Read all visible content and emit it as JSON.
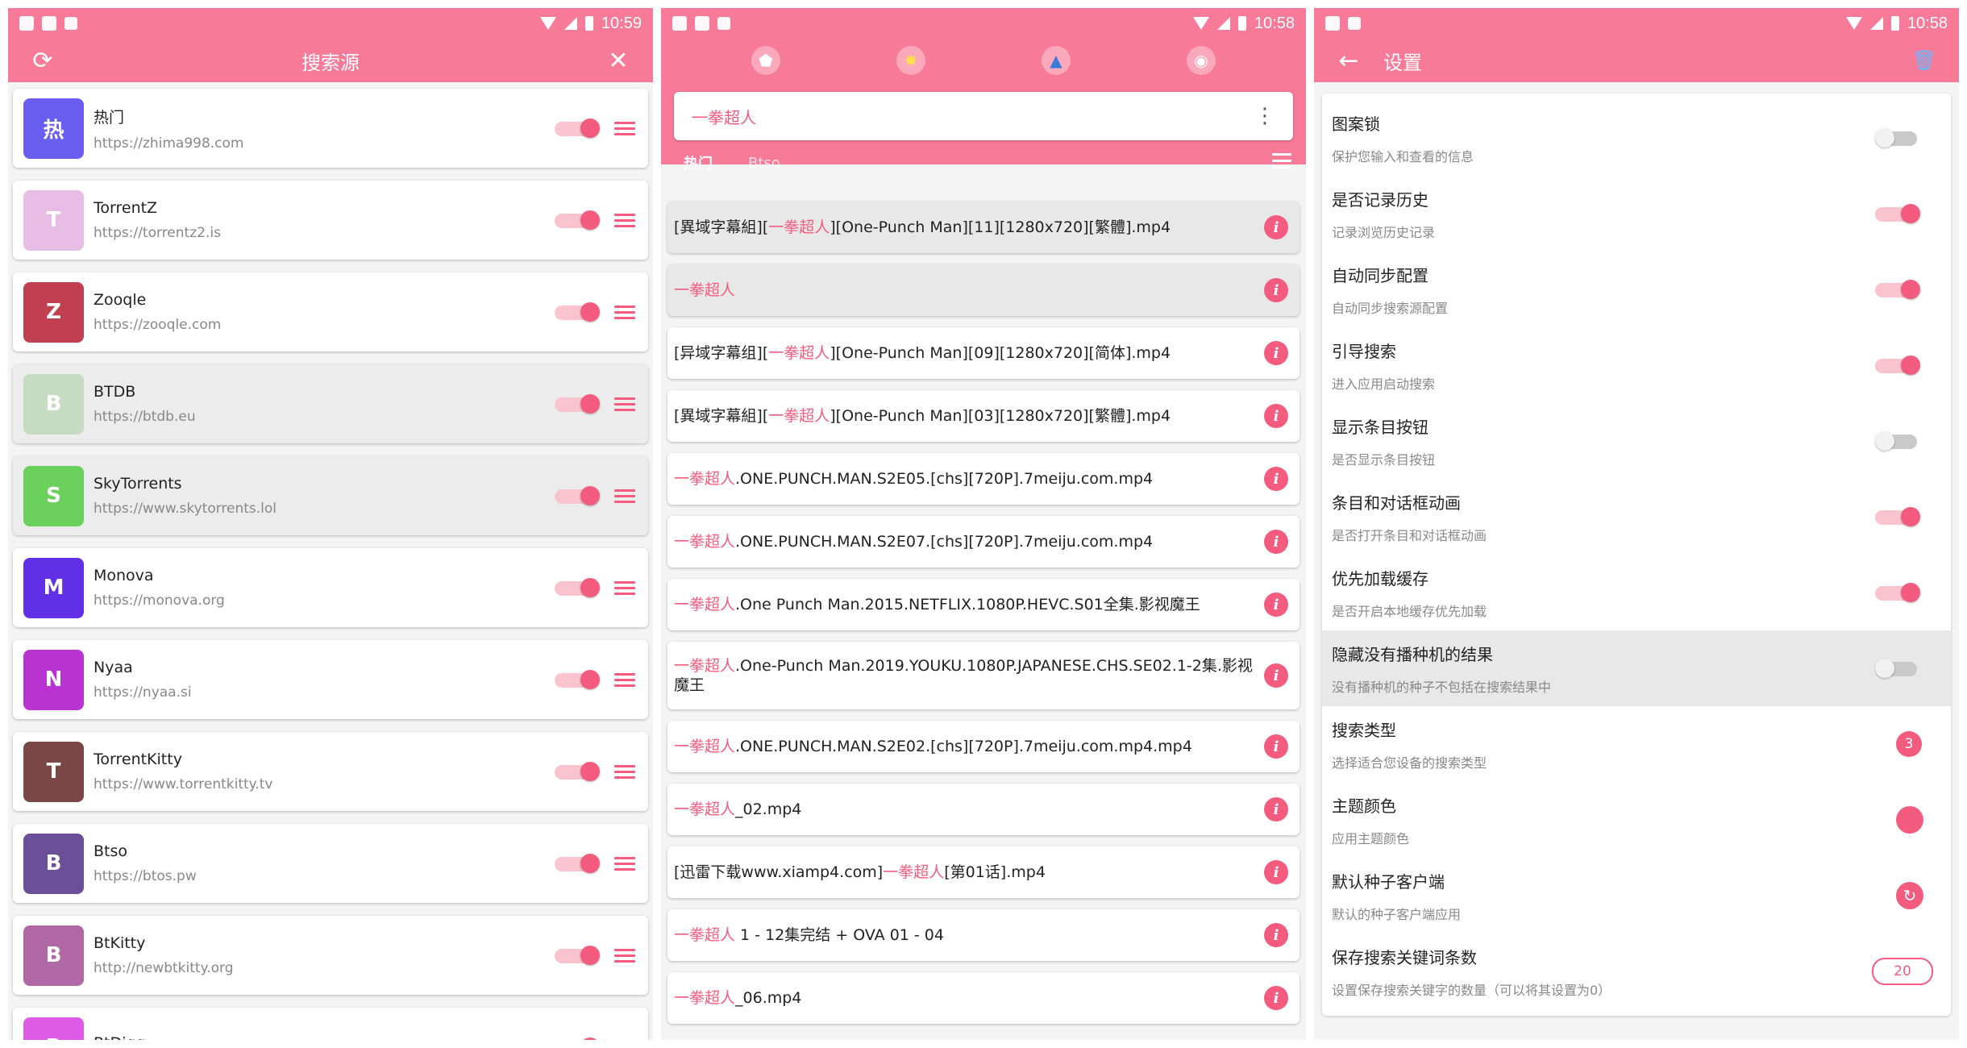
{
  "status": {
    "time1": "10:59",
    "time2": "10:58",
    "time3": "10:58"
  },
  "p1": {
    "title": "搜索源",
    "sources": [
      {
        "letter": "热",
        "name": "热门",
        "url": "https://zhima998.com",
        "color": "#6a5df2",
        "enabled": true
      },
      {
        "letter": "T",
        "name": "TorrentZ",
        "url": "https://torrentz2.is",
        "color": "#e7bde6",
        "enabled": true
      },
      {
        "letter": "Z",
        "name": "Zooqle",
        "url": "https://zooqle.com",
        "color": "#c1404f",
        "enabled": true
      },
      {
        "letter": "B",
        "name": "BTDB",
        "url": "https://btdb.eu",
        "color": "#c5dcc0",
        "enabled": true
      },
      {
        "letter": "S",
        "name": "SkyTorrents",
        "url": "https://www.skytorrents.lol",
        "color": "#6ad25c",
        "enabled": true
      },
      {
        "letter": "M",
        "name": "Monova",
        "url": "https://monova.org",
        "color": "#6130e6",
        "enabled": true
      },
      {
        "letter": "N",
        "name": "Nyaa",
        "url": "https://nyaa.si",
        "color": "#b932d2",
        "enabled": true
      },
      {
        "letter": "T",
        "name": "TorrentKitty",
        "url": "https://www.torrentkitty.tv",
        "color": "#7b4646",
        "enabled": true
      },
      {
        "letter": "B",
        "name": "Btso",
        "url": "https://btos.pw",
        "color": "#6b4f99",
        "enabled": true
      },
      {
        "letter": "B",
        "name": "BtKitty",
        "url": "http://newbtkitty.org",
        "color": "#b068a7",
        "enabled": true
      },
      {
        "letter": "B",
        "name": "BtDigg",
        "url": "",
        "color": "#e05be5",
        "enabled": true
      }
    ]
  },
  "p2": {
    "query": "一拳超人",
    "tab_hot": "热门",
    "tab_btso": "Btso",
    "results": [
      {
        "pre": "[異域字幕組][",
        "hl": "一拳超人",
        "post": "][One-Punch Man][11][1280x720][繁體].mp4"
      },
      {
        "pre": "",
        "hl": "一拳超人",
        "post": ""
      },
      {
        "pre": "[异域字幕组][",
        "hl": "一拳超人",
        "post": "][One-Punch Man][09][1280x720][简体].mp4"
      },
      {
        "pre": "[異域字幕組][",
        "hl": "一拳超人",
        "post": "][One-Punch Man][03][1280x720][繁體].mp4"
      },
      {
        "pre": "",
        "hl": "一拳超人",
        "post": ".ONE.PUNCH.MAN.S2E05.[chs][720P].7meiju.com.mp4"
      },
      {
        "pre": "",
        "hl": "一拳超人",
        "post": ".ONE.PUNCH.MAN.S2E07.[chs][720P].7meiju.com.mp4"
      },
      {
        "pre": "",
        "hl": "一拳超人",
        "post": ".One Punch Man.2015.NETFLIX.1080P.HEVC.S01全集.影视魔王"
      },
      {
        "pre": "",
        "hl": "一拳超人",
        "post": ".One-Punch Man.2019.YOUKU.1080P.JAPANESE.CHS.SE02.1-2集.影视魔王"
      },
      {
        "pre": "",
        "hl": "一拳超人",
        "post": ".ONE.PUNCH.MAN.S2E02.[chs][720P].7meiju.com.mp4.mp4"
      },
      {
        "pre": "",
        "hl": "一拳超人",
        "post": "_02.mp4"
      },
      {
        "pre": "[迅雷下载www.xiamp4.com]",
        "hl": "一拳超人",
        "post": "[第01话].mp4"
      },
      {
        "pre": "",
        "hl": "一拳超人",
        "post": " 1 - 12集完结 + OVA 01 - 04"
      },
      {
        "pre": "",
        "hl": "一拳超人",
        "post": "_06.mp4"
      }
    ]
  },
  "p3": {
    "title": "设置",
    "rows": [
      {
        "title": "图案锁",
        "sub": "保护您输入和查看的信息",
        "kind": "toggle",
        "on": false
      },
      {
        "title": "是否记录历史",
        "sub": "记录浏览历史记录",
        "kind": "toggle",
        "on": true
      },
      {
        "title": "自动同步配置",
        "sub": "自动同步搜索源配置",
        "kind": "toggle",
        "on": true
      },
      {
        "title": "引导搜索",
        "sub": "进入应用启动搜索",
        "kind": "toggle",
        "on": true
      },
      {
        "title": "显示条目按钮",
        "sub": "是否显示条目按钮",
        "kind": "toggle",
        "on": false
      },
      {
        "title": "条目和对话框动画",
        "sub": "是否打开条目和对话框动画",
        "kind": "toggle",
        "on": true
      },
      {
        "title": "优先加载缓存",
        "sub": "是否开启本地缓存优先加载",
        "kind": "toggle",
        "on": true
      },
      {
        "title": "隐藏没有播种机的结果",
        "sub": "没有播种机的种子不包括在搜索结果中",
        "kind": "toggle",
        "on": false
      },
      {
        "title": "搜索类型",
        "sub": "选择适合您设备的搜索类型",
        "kind": "badge",
        "value": "3"
      },
      {
        "title": "主题颜色",
        "sub": "应用主题颜色",
        "kind": "color"
      },
      {
        "title": "默认种子客户端",
        "sub": "默认的种子客户端应用",
        "kind": "client"
      },
      {
        "title": "保存搜索关键词条数",
        "sub": "设置保存搜索关键字的数量（可以将其设置为0）",
        "kind": "pill",
        "value": "20"
      }
    ]
  },
  "colors": {
    "accent": "#f77a98",
    "accent_dark": "#f45c7f"
  }
}
